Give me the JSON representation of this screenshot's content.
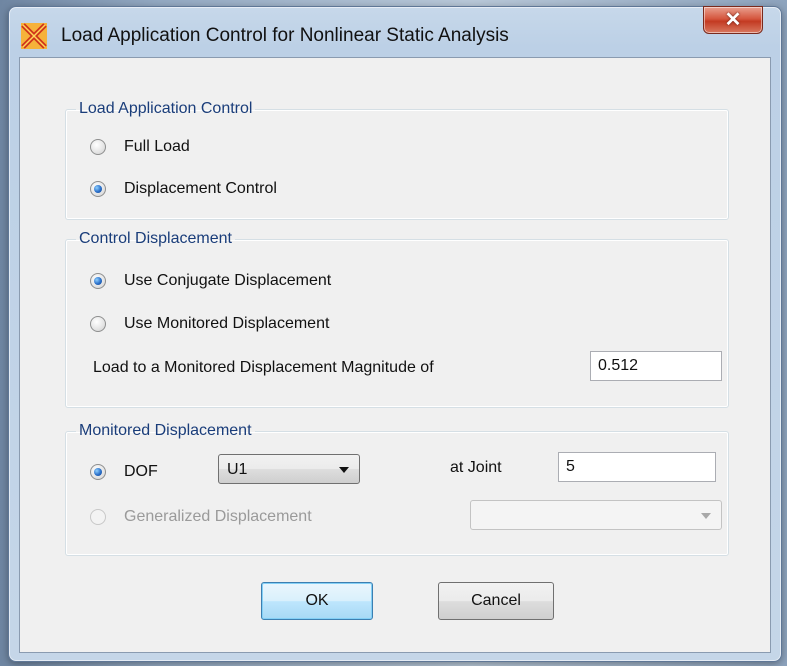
{
  "window": {
    "title": "Load Application Control for Nonlinear Static Analysis",
    "close_glyph": "✕",
    "icon": "app-logo-icon"
  },
  "load_application_control": {
    "legend": "Load Application Control",
    "full_load_label": "Full Load",
    "full_load_checked": false,
    "displacement_control_label": "Displacement Control",
    "displacement_control_checked": true
  },
  "control_displacement": {
    "legend": "Control Displacement",
    "use_conjugate_label": "Use Conjugate Displacement",
    "use_conjugate_checked": true,
    "use_monitored_label": "Use Monitored Displacement",
    "use_monitored_checked": false,
    "magnitude_label": "Load to a Monitored Displacement Magnitude of",
    "magnitude_value": "0.512"
  },
  "monitored_displacement": {
    "legend": "Monitored Displacement",
    "dof_label": "DOF",
    "dof_checked": true,
    "dof_selected": "U1",
    "at_joint_label": "at Joint",
    "joint_value": "5",
    "generalized_label": "Generalized Displacement",
    "generalized_checked": false,
    "generalized_enabled": false,
    "generalized_selected": ""
  },
  "buttons": {
    "ok_label": "OK",
    "cancel_label": "Cancel"
  },
  "colors": {
    "legend_text": "#1a3d7a",
    "close_button": "#c33a22",
    "client_bg": "#f0f0f0"
  }
}
